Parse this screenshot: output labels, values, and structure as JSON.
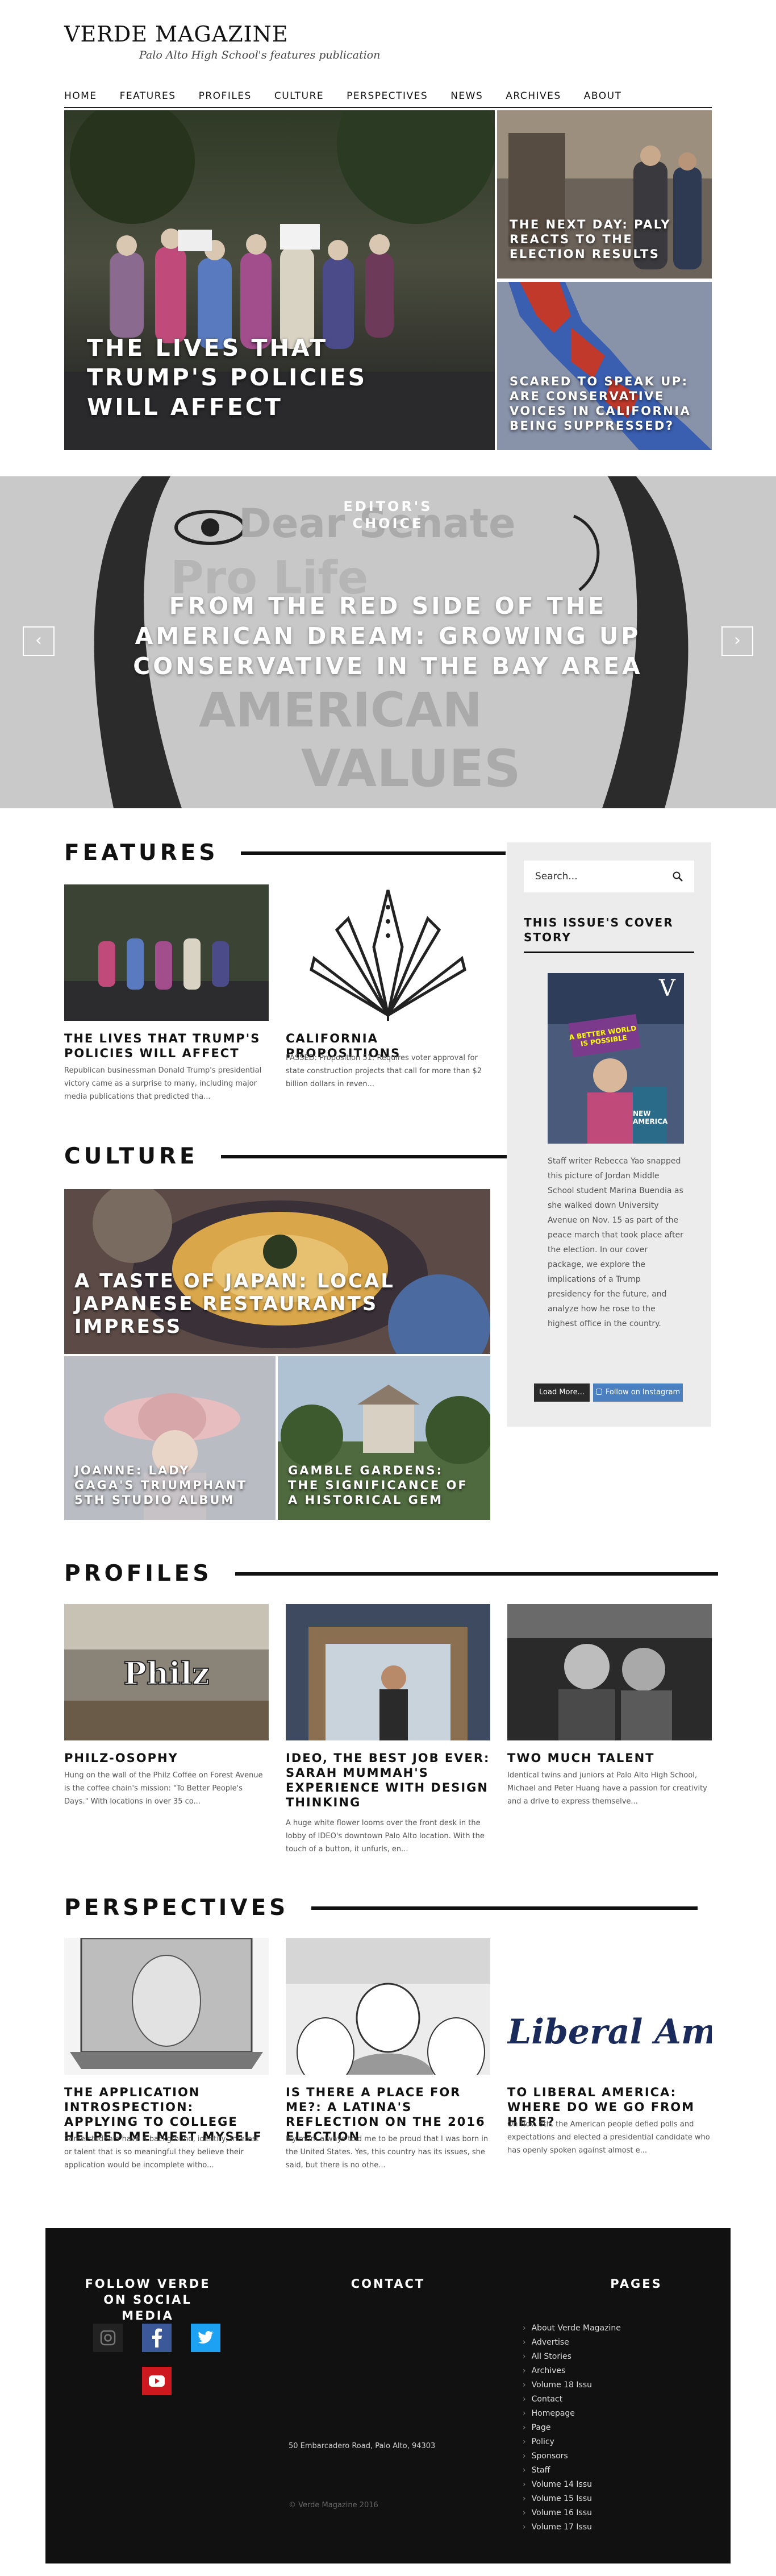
{
  "header": {
    "title": "VERDE MAGAZINE",
    "tagline": "Palo Alto High School's features publication"
  },
  "nav": [
    "HOME",
    "FEATURES",
    "PROFILES",
    "CULTURE",
    "PERSPECTIVES",
    "NEWS",
    "ARCHIVES",
    "ABOUT"
  ],
  "hero": {
    "main": "THE LIVES THAT TRUMP'S POLICIES WILL AFFECT",
    "side1": "THE NEXT DAY: PALY REACTS TO THE ELECTION RESULTS",
    "side2": "SCARED TO SPEAK UP: ARE CONSERVATIVE VOICES IN CALIFORNIA BEING SUPPRESSED?"
  },
  "slider": {
    "label": "EDITOR'S CHOICE",
    "title": "FROM THE RED SIDE OF THE AMERICAN DREAM: GROWING UP CONSERVATIVE IN THE BAY AREA",
    "bg_words": [
      "Dear Senate",
      "Pro Life",
      "AMERICAN",
      "VALUES"
    ],
    "prev": "‹",
    "next": "›"
  },
  "features": {
    "heading": "FEATURES",
    "cards": [
      {
        "title": "THE LIVES THAT TRUMP'S POLICIES WILL AFFECT",
        "excerpt": "Republican businessman Donald Trump's presidential victory came as a surprise to many, including major media publications that predicted tha..."
      },
      {
        "title": "CALIFORNIA PROPOSITIONS",
        "excerpt": "PASSED: Proposition 51: Requires voter approval for state construction projects that call for more than $2 billion dollars in reven..."
      }
    ]
  },
  "culture": {
    "heading": "CULTURE",
    "main": "A TASTE OF JAPAN: LOCAL JAPANESE RESTAURANTS IMPRESS",
    "tiles": [
      "JOANNE: LADY GAGA'S TRIUMPHANT 5TH STUDIO ALBUM",
      "GAMBLE GARDENS: THE SIGNIFICANCE OF A HISTORICAL GEM"
    ]
  },
  "profiles": {
    "heading": "PROFILES",
    "cards": [
      {
        "title": "PHILZ-OSOPHY",
        "excerpt": "Hung on the wall of the Philz Coffee on Forest Avenue is the coffee chain's mission: \"To Better People's Days.\" With locations in over 35 co...",
        "img_text": "Philz"
      },
      {
        "title": "IDEO, THE BEST JOB EVER: SARAH MUMMAH'S EXPERIENCE WITH DESIGN THINKING",
        "excerpt": "A huge white flower looms over the front desk in the lobby of IDEO's downtown Palo Alto location. With the touch of a button, it unfurls, en..."
      },
      {
        "title": "TWO MUCH TALENT",
        "excerpt": "Identical twins and juniors at Palo Alto High School, Michael and Peter Huang have a passion for creativity and a drive to express themselve..."
      }
    ]
  },
  "perspectives": {
    "heading": "PERSPECTIVES",
    "cards": [
      {
        "title": "THE APPLICATION INTROSPECTION: APPLYING TO COLLEGE HELPED ME MEET MYSELF",
        "excerpt": "Some students have a background, identity, interest or talent that is so meaningful they believe their application would be incomplete witho..."
      },
      {
        "title": "IS THERE A PLACE FOR ME?: A LATINA'S REFLECTION ON THE 2016 ELECTION",
        "excerpt": "My mom always told me to be proud that I was born in the United States. Yes, this country has its issues, she said, but there is no othe..."
      },
      {
        "title": "TO LIBERAL AMERICA: WHERE DO WE GO FROM HERE?",
        "excerpt": "On Nov. 8th, the American people defied polls and expectations and elected a presidential candidate who has openly spoken against almost e...",
        "img_text": "Liberal Am"
      }
    ]
  },
  "sidebar": {
    "search_placeholder": "Search...",
    "cover_heading": "THIS ISSUE'S COVER STORY",
    "cover_text": "Staff writer Rebecca Yao snapped this picture of Jordan Middle School student Marina Buendia as she walked down University Avenue on Nov. 15 as part of the peace march that took place after the election. In our cover package, we explore the implications of a Trump presidency for the future, and analyze how he rose to the highest office in the country.",
    "cover_sign": "A BETTER WORLD IS POSSIBLE",
    "cover_corner": "NEW AMERICA",
    "load_more": "Load More...",
    "instagram": "Follow on Instagram"
  },
  "footer": {
    "social_heading": "FOLLOW VERDE ON SOCIAL MEDIA",
    "contact_heading": "CONTACT",
    "pages_heading": "PAGES",
    "address": "50 Embarcadero Road, Palo Alto, 94303",
    "copyright": "© Verde Magazine 2016",
    "pages": [
      "About Verde Magazine",
      "Advertise",
      "All Stories",
      "Archives",
      "Volume 18 Issu",
      "Contact",
      "Homepage",
      "Page",
      "Policy",
      "Sponsors",
      "Staff",
      "Volume 14 Issu",
      "Volume 15 Issu",
      "Volume 16 Issu",
      "Volume 17 Issu"
    ]
  },
  "colors": {
    "accent_dark": "#111111",
    "sidebar_bg": "#ececec",
    "instagram_blue": "#4a7fc0",
    "facebook_blue": "#3b5998",
    "twitter_blue": "#1da1f2",
    "youtube_red": "#cc181e"
  }
}
